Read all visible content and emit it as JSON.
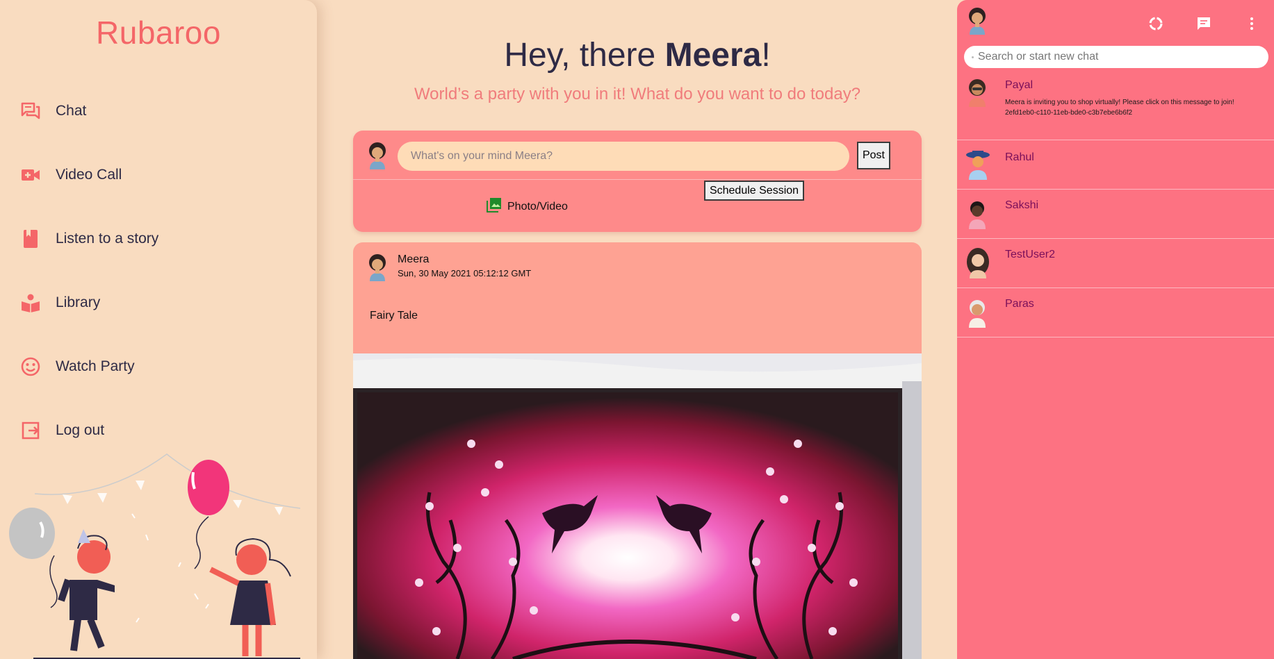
{
  "sidebar": {
    "brand": "Rubaroo",
    "items": [
      {
        "label": "Chat",
        "icon": "forum-icon"
      },
      {
        "label": "Video Call",
        "icon": "video-call-icon"
      },
      {
        "label": "Listen to a story",
        "icon": "book-icon"
      },
      {
        "label": "Library",
        "icon": "reader-icon"
      },
      {
        "label": "Watch Party",
        "icon": "smiley-icon"
      },
      {
        "label": "Log out",
        "icon": "logout-icon"
      }
    ]
  },
  "main": {
    "greeting_prefix": "Hey, there ",
    "greeting_name": "Meera",
    "greeting_suffix": "!",
    "subtitle": "World’s a party with you in it! What do you want to do today?",
    "composer": {
      "placeholder": "What's on your mind Meera?",
      "post_label": "Post",
      "photo_label": "Photo/Video",
      "schedule_label": "Schedule Session"
    },
    "post": {
      "author": "Meera",
      "date": "Sun, 30 May 2021 05:12:12 GMT",
      "text": "Fairy Tale",
      "image_icon": "painting-birds-moon"
    }
  },
  "chat": {
    "search_placeholder": "Search or start new chat",
    "toolbar_icons": [
      "refresh-icon",
      "message-icon",
      "more-vert-icon"
    ],
    "conversations": [
      {
        "name": "Payal",
        "message": "Meera is inviting you to shop virtually! Please click on this message to join! 2efd1eb0-c110-11eb-bde0-c3b7ebe6b6f2"
      },
      {
        "name": "Rahul",
        "message": ""
      },
      {
        "name": "Sakshi",
        "message": ""
      },
      {
        "name": "TestUser2",
        "message": ""
      },
      {
        "name": "Paras",
        "message": ""
      }
    ]
  },
  "colors": {
    "background": "#f9dcc0",
    "accent": "#f46668",
    "chat_panel": "#fd7282",
    "composer": "#fe8a8a",
    "post_card": "#fea293",
    "contact_name": "#7a0f5a"
  }
}
